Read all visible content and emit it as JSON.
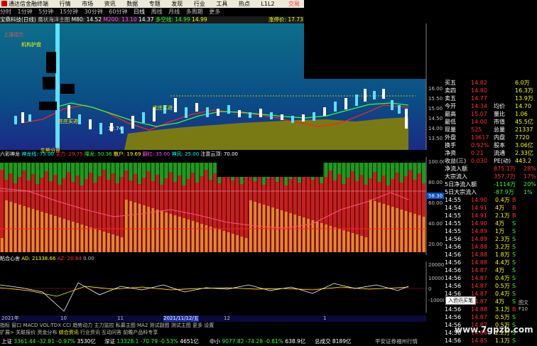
{
  "menu": {
    "app_title": "通达信金融终端",
    "items": [
      "行情",
      "市场",
      "资讯",
      "数据",
      "专题",
      "发现",
      "行业",
      "工具",
      "热点",
      "L1L2"
    ],
    "trade": "交易"
  },
  "periods": {
    "items": [
      "分时",
      "1分钟",
      "5分钟",
      "15分钟",
      "30分钟",
      "60分钟",
      "日线",
      "周线",
      "月线",
      "多周期",
      "更多"
    ],
    "active": "日线"
  },
  "main_title": {
    "stock": "宝鼎科技(日线)",
    "indicator": "鹰状海洋主图",
    "m80": "M80: 14.52",
    "m200": "M200: 13.10",
    "price_tag": "14.37",
    "duokong": "多空线: 14.99",
    "value2": "14.99",
    "zhang": "涨停价: 17.73"
  },
  "main_chart": {
    "labels": [
      "上涨动力",
      "机构护盘",
      "牛熊分界"
    ],
    "low_price": "12.74",
    "zhuang": [
      "庄庄买进",
      "庄庄买进"
    ],
    "price_axis": [
      "16.00",
      "15.50",
      "15.00",
      "14.50",
      "14.00",
      "13.50"
    ]
  },
  "sub1": {
    "title": "六彩神龙",
    "shenlong": "神龙线: 75.00",
    "zhuli": "主力: 29.75",
    "xianglong": "降龙: 50.36",
    "sanhu": "散户: 19.69",
    "fanhong": "翻红: 35.00",
    "shenfeng": "神风: 25.00",
    "attention": "注意云顶: 70.00",
    "axis": [
      "100.00",
      "80.00",
      "60.00",
      "40.00",
      "20.00"
    ],
    "mark": "58.30"
  },
  "sub2": {
    "title": "粘合心舍",
    "ad": "AD: 21338.66",
    "az": "AZ: 20.64",
    "x": "0.00",
    "axis": [
      "20000",
      "10000",
      "0",
      "-10000"
    ]
  },
  "xaxis": {
    "labels": [
      "2021年",
      "10",
      "11",
      "2021/11/12/五",
      "12",
      "1"
    ]
  },
  "ind_tabs": [
    "指标",
    "窗口",
    "MACD",
    "VOL-TDX",
    "CCI",
    "趋势动力",
    "主力监控",
    "私募主图",
    "MA2",
    "测试副图",
    "测试主图",
    "更多",
    "设置"
  ],
  "ext_tabs": [
    "扩展>",
    "关联报价",
    "资金分布",
    "综合资讯",
    "行业资讯",
    "互动问答",
    "前瞻产品科专享"
  ],
  "quote": {
    "ask": [
      {
        "l": "买五",
        "p": "14.82",
        "v": "6.0万"
      },
      {
        "l": "卖四",
        "p": "14.80",
        "v": "16.3万"
      },
      {
        "l": "卖五",
        "p": "14.77",
        "v": "13.9万"
      }
    ],
    "stats": [
      {
        "l": "今开",
        "p": "14.34",
        "l2": "均价",
        "v": "14.70"
      },
      {
        "l": "最高",
        "p": "15.07",
        "l2": "量比",
        "v": "1.06"
      },
      {
        "l": "最低",
        "p": "14.00",
        "l2": "市值",
        "v": "45.5亿"
      },
      {
        "l": "现量",
        "p": "525",
        "l2": "总量",
        "v": "21337"
      },
      {
        "l": "外盘",
        "p": "13617",
        "l2": "内盘",
        "v": "7720"
      },
      {
        "l": "换手",
        "p": "0.92%",
        "l2": "股本",
        "v": "3.06亿"
      },
      {
        "l": "净资",
        "p": "0.21",
        "l2": "流通",
        "v": "2.33亿"
      },
      {
        "l": "收益(三)",
        "p": "0.030",
        "l2": "PE(动)",
        "v": "443.2"
      }
    ],
    "flows": [
      {
        "l": "净流入额",
        "v": "875.1万",
        "p": "28%"
      },
      {
        "l": "大宗流入",
        "v": "357.7万",
        "p": "17%"
      },
      {
        "l": "5日净流入额",
        "v": "-1114万",
        "p": "20%"
      },
      {
        "l": "5日大宗流入",
        "v": "-87.9万",
        "p": "1%"
      }
    ],
    "ticks": [
      {
        "t": "14:55",
        "p": "14.90",
        "v": "0.4万",
        "s": "B"
      },
      {
        "t": "14:54",
        "p": "14.91",
        "v": "4万",
        "s": "B"
      },
      {
        "t": "14:55",
        "p": "14.91",
        "v": "2.1万",
        "s": "B"
      },
      {
        "t": "14:55",
        "p": "14.90",
        "v": "4万",
        "s": "S"
      },
      {
        "t": "14:55",
        "p": "14.89",
        "v": "1万",
        "s": "S"
      },
      {
        "t": "14:56",
        "p": "14.89",
        "v": "2.3万",
        "s": "S"
      },
      {
        "t": "14:56",
        "p": "14.88",
        "v": "3.2万",
        "s": "S"
      },
      {
        "t": "14:56",
        "p": "14.88",
        "v": "1.8万",
        "s": "S"
      },
      {
        "t": "14:56",
        "p": "14.88",
        "v": "4.4万",
        "s": "S"
      },
      {
        "t": "14:56",
        "p": "14.87",
        "v": "4万",
        "s": "S"
      },
      {
        "t": "14:56",
        "p": "14.87",
        "v": "0.4万",
        "s": "S"
      },
      {
        "t": "14:56",
        "p": "14.87",
        "v": "0.5万",
        "s": "S"
      },
      {
        "t": "14:56",
        "p": "14.87",
        "v": "0.4万",
        "s": "S"
      },
      {
        "t": "14:56",
        "p": "14.87",
        "v": "4万",
        "s": "S"
      },
      {
        "t": "14:56",
        "p": "14.88",
        "v": "3.1万",
        "s": "B"
      },
      {
        "t": "14:56",
        "p": "14.87",
        "v": "0.5万",
        "s": "S"
      },
      {
        "t": "14:56",
        "p": "14.87",
        "v": "0.5万",
        "s": "S"
      },
      {
        "t": "14:56",
        "p": "14.86",
        "v": "2.2万",
        "s": "S"
      },
      {
        "t": "14:56",
        "p": "14.85",
        "v": "1.1万",
        "s": "S"
      }
    ],
    "popup": "入资讯买笔"
  },
  "bottom": {
    "bottom_btns": [
      "模板",
      "图文F10"
    ],
    "indices": [
      {
        "name": "上证",
        "val": "3361.44",
        "chg": "-32.81",
        "pct": "-0.97%",
        "amt": "3530亿"
      },
      {
        "name": "深证",
        "val": "13328.1",
        "chg": "-70.79",
        "pct": "-0.53%",
        "amt": "4651亿"
      },
      {
        "name": "中小",
        "val": "9077.82",
        "chg": "-74.28",
        "pct": "-0.81%",
        "amt": "638.9亿"
      }
    ],
    "total": "总成交",
    "total_val": "8189亿",
    "broker": "平安证券福州行情"
  },
  "watermark": "www.7gpzb.com"
}
